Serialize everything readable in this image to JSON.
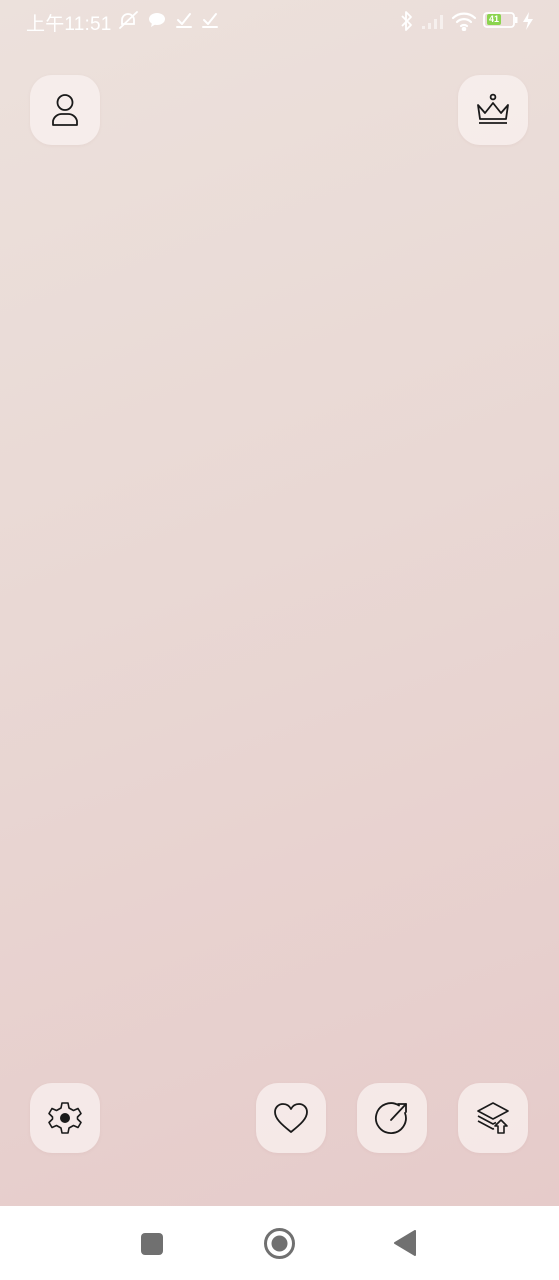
{
  "status_bar": {
    "time": "上午11:51",
    "battery_level": "41",
    "icons": [
      "mute-icon",
      "chat-bubble-icon",
      "download-done-icon",
      "download-done-icon",
      "bluetooth-icon",
      "signal-icon",
      "wifi-icon",
      "battery-icon",
      "charging-icon"
    ]
  },
  "top_buttons": {
    "left": "user-icon",
    "right": "crown-icon"
  },
  "bottom_buttons": [
    "settings-icon",
    "heart-icon",
    "share-icon",
    "layers-icon"
  ],
  "nav_bar": [
    "recent-apps-icon",
    "home-icon",
    "back-icon"
  ],
  "colors": {
    "background_top": "#ece1dc",
    "background_bottom": "#e6cbca",
    "tile": "#f6ecea",
    "icon_stroke": "#1a1a1a",
    "nav_icon": "#707070",
    "battery": "#8bd44e"
  }
}
